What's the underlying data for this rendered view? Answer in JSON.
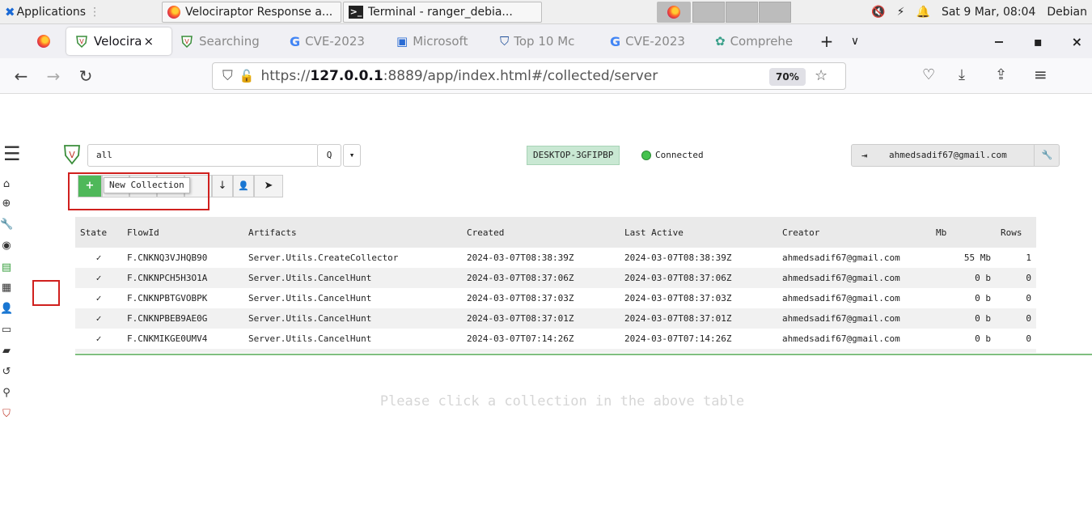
{
  "os_bar": {
    "applications_label": "Applications",
    "tasks": [
      {
        "label": "Velociraptor Response a..."
      },
      {
        "label": "Terminal - ranger_debia..."
      }
    ],
    "datetime": "Sat  9 Mar, 08:04",
    "user_label": "Debian"
  },
  "browser": {
    "tabs": [
      {
        "label": "Velocira",
        "close": "×",
        "active": true
      },
      {
        "label": "Searching",
        "active": false
      },
      {
        "label": "CVE-2023",
        "active": false
      },
      {
        "label": "Microsoft",
        "active": false
      },
      {
        "label": "Top 10 Mc",
        "active": false
      },
      {
        "label": "CVE-2023",
        "active": false
      },
      {
        "label": "Comprehe",
        "active": false
      }
    ],
    "new_tab": "+",
    "tab_list": "∨",
    "minimize": "−",
    "maximize": "▪",
    "close": "×",
    "url": {
      "prefix": "https://",
      "host": "127.0.0.1",
      "rest": ":8889/app/index.html#/collected/server"
    },
    "zoom": "70%"
  },
  "app": {
    "search_value": "all",
    "search_button": "Q",
    "dropdown_button": "▾",
    "host_badge": "DESKTOP-3GFIPBP",
    "connection_status": "Connected",
    "logout_icon_glyph": "⇥",
    "user_email": "ahmedsadif67@gmail.com",
    "settings_glyph": "🔧"
  },
  "collection_toolbar": {
    "new_label": "+",
    "tooltip": "New Collection",
    "download_glyph": "↓",
    "user_glyph": "👤",
    "send_glyph": "➤"
  },
  "table": {
    "columns": [
      "State",
      "FlowId",
      "Artifacts",
      "Created",
      "Last Active",
      "Creator",
      "Mb",
      "Rows"
    ],
    "rows": [
      {
        "state": "✓",
        "flow_id": "F.CNKNQ3VJHQB90",
        "artifact": "Server.Utils.CreateCollector",
        "created": "2024-03-07T08:38:39Z",
        "last_active": "2024-03-07T08:38:39Z",
        "creator": "ahmedsadif67@gmail.com",
        "mb": "55 Mb",
        "rows": "1"
      },
      {
        "state": "✓",
        "flow_id": "F.CNKNPCH5H3O1A",
        "artifact": "Server.Utils.CancelHunt",
        "created": "2024-03-07T08:37:06Z",
        "last_active": "2024-03-07T08:37:06Z",
        "creator": "ahmedsadif67@gmail.com",
        "mb": "0 b",
        "rows": "0"
      },
      {
        "state": "✓",
        "flow_id": "F.CNKNPBTGVOBPK",
        "artifact": "Server.Utils.CancelHunt",
        "created": "2024-03-07T08:37:03Z",
        "last_active": "2024-03-07T08:37:03Z",
        "creator": "ahmedsadif67@gmail.com",
        "mb": "0 b",
        "rows": "0"
      },
      {
        "state": "✓",
        "flow_id": "F.CNKNPBEB9AE0G",
        "artifact": "Server.Utils.CancelHunt",
        "created": "2024-03-07T08:37:01Z",
        "last_active": "2024-03-07T08:37:01Z",
        "creator": "ahmedsadif67@gmail.com",
        "mb": "0 b",
        "rows": "0"
      },
      {
        "state": "✓",
        "flow_id": "F.CNKMIKGE0UMV4",
        "artifact": "Server.Utils.CancelHunt",
        "created": "2024-03-07T07:14:26Z",
        "last_active": "2024-03-07T07:14:26Z",
        "creator": "ahmedsadif67@gmail.com",
        "mb": "0 b",
        "rows": "0"
      }
    ]
  },
  "empty_message": "Please click a collection in the above table",
  "colors": {
    "accent_green": "#45c24e",
    "highlight_red": "#d0201e",
    "host_badge_bg": "#c9e8d3"
  }
}
